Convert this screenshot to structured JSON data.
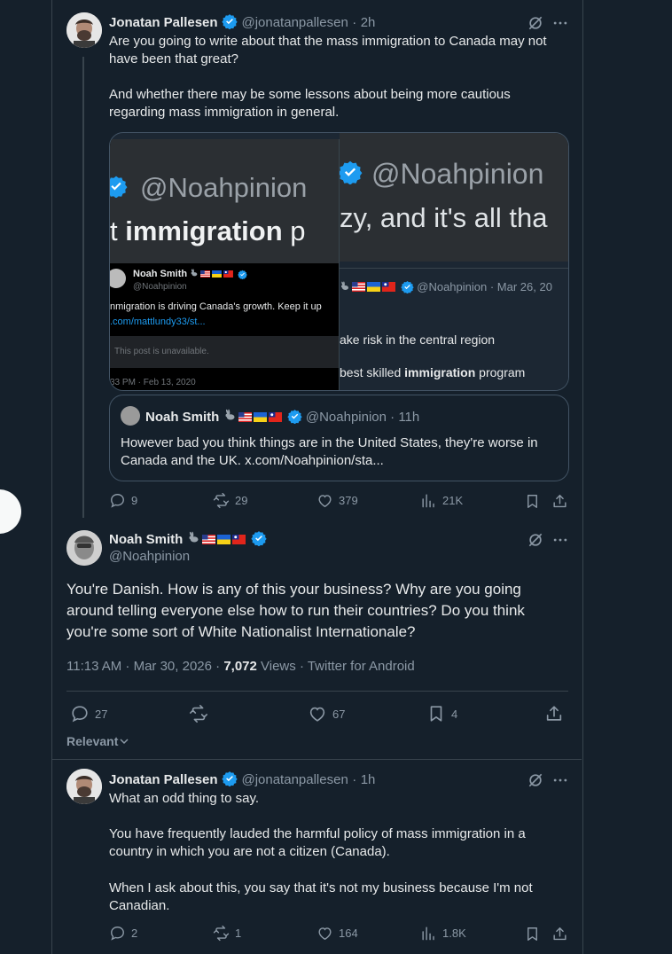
{
  "post1": {
    "name": "Jonatan Pallesen",
    "handle": "@jonatanpallesen",
    "sep": "·",
    "time": "2h",
    "text_p1": "Are you going to write about that the mass immigration to Canada may not have been that great?",
    "text_p2": "And whether there may be some lessons about being more cautious regarding mass immigration in general.",
    "media": {
      "left_watermark": "@Noahpinion",
      "left_caption_prefix": "t ",
      "left_caption_bold": "immigration",
      "left_caption_suffix": " p",
      "right_watermark": "@Noahpinion",
      "right_caption": "zy, and it's all tha",
      "inner_name": "Noah Smith",
      "inner_handle": "@Noahpinion",
      "inner_text": "nmigration is driving Canada's growth. Keep it up",
      "inner_link": ".com/mattlundy33/st...",
      "inner_unavailable": "This post is unavailable.",
      "inner_date": "33 PM · Feb 13, 2020",
      "right_handle": "@Noahpinion · Mar 26, 20",
      "right_line1": "ake risk in the central region",
      "right_line2_prefix": "best skilled ",
      "right_line2_bold": "immigration",
      "right_line2_suffix": " program"
    },
    "quote": {
      "name": "Noah Smith",
      "handle": "@Noahpinion",
      "sep": "·",
      "time": "11h",
      "text": "However bad you think things are in the United States, they're worse in Canada and the UK. x.com/Noahpinion/sta..."
    },
    "actions": {
      "replies": "9",
      "reposts": "29",
      "likes": "379",
      "views": "21K"
    }
  },
  "main_post": {
    "name": "Noah Smith",
    "handle": "@Noahpinion",
    "text": "You're Danish. How is any of this your business? Why are you going around telling everyone else how to run their countries? Do you think you're some sort of White Nationalist Internationale?",
    "timestamp": "11:13 AM · Mar 30, 2026 · ",
    "views_count": "7,072",
    "views_label": " Views",
    "source": " · Twitter for Android",
    "actions": {
      "replies": "27",
      "reposts": "",
      "likes": "67",
      "bookmarks": "4"
    },
    "sort_label": "Relevant"
  },
  "reply": {
    "name": "Jonatan Pallesen",
    "handle": "@jonatanpallesen",
    "sep": "·",
    "time": "1h",
    "p1": "What an odd thing to say.",
    "p2": "You have frequently lauded the harmful policy of mass immigration in a country in which you are not a citizen (Canada).",
    "p3": "When I ask about this, you say that it's not my business because I'm not Canadian.",
    "actions": {
      "replies": "2",
      "reposts": "1",
      "likes": "164",
      "views": "1.8K"
    }
  },
  "colors": {
    "bg": "#15202b",
    "text": "#e7e9ea",
    "muted": "#8b98a5",
    "border": "#38444d",
    "verified": "#1d9bf0"
  }
}
